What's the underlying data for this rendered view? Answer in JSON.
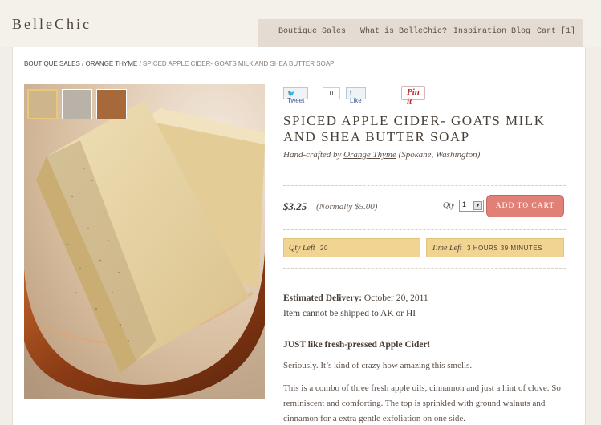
{
  "brand": {
    "logo_text": "BelleChic"
  },
  "nav": {
    "items": [
      "Boutique Sales",
      "What is BelleChic?",
      "Inspiration Blog",
      "Cart [1]"
    ]
  },
  "breadcrumb": {
    "items": [
      "Boutique Sales",
      "Orange Thyme"
    ],
    "current": "Spiced Apple Cider- Goats Milk and Shea Butter Soap"
  },
  "social": {
    "tweet_label": "Tweet",
    "tweet_count": "0",
    "like_label": "Like",
    "pin_label": "Pin it"
  },
  "product": {
    "title": "Spiced Apple Cider- Goats Milk and Shea Butter Soap",
    "maker_prefix": "Hand-crafted by",
    "maker_name": "Orange Thyme",
    "maker_location": "(Spokane, Washington)",
    "price": "$3.25",
    "normal_price": "(Normally $5.00)",
    "qty_label": "Qty",
    "qty_value": "1",
    "add_to_cart_label": "Add to cart"
  },
  "availability": {
    "qty_left_label": "Qty Left",
    "qty_left_value": "20",
    "time_left_label": "Time Left",
    "time_left_value": "3 Hours 39 Minutes"
  },
  "delivery": {
    "label": "Estimated Delivery:",
    "date": "October 20, 2011",
    "note": "Item cannot be shipped to AK or HI"
  },
  "description": {
    "headline": "JUST like fresh-pressed Apple Cider!",
    "p1": "Seriously.  It’s kind of crazy how amazing this smells.",
    "p2": "This is a combo of three fresh apple oils, cinnamon and just a hint of clove.  So reminiscent and comforting.  The top is sprinkled with ground walnuts and cinnamon for a extra gentle exfoliation on one side."
  },
  "colors": {
    "accent_button": "#e08077",
    "info_box": "#f1d491",
    "text": "#4a3f36"
  },
  "icons": [
    "soap-photo",
    "dropdown-arrow-icon",
    "pinterest-icon",
    "twitter-icon",
    "facebook-like-icon"
  ]
}
